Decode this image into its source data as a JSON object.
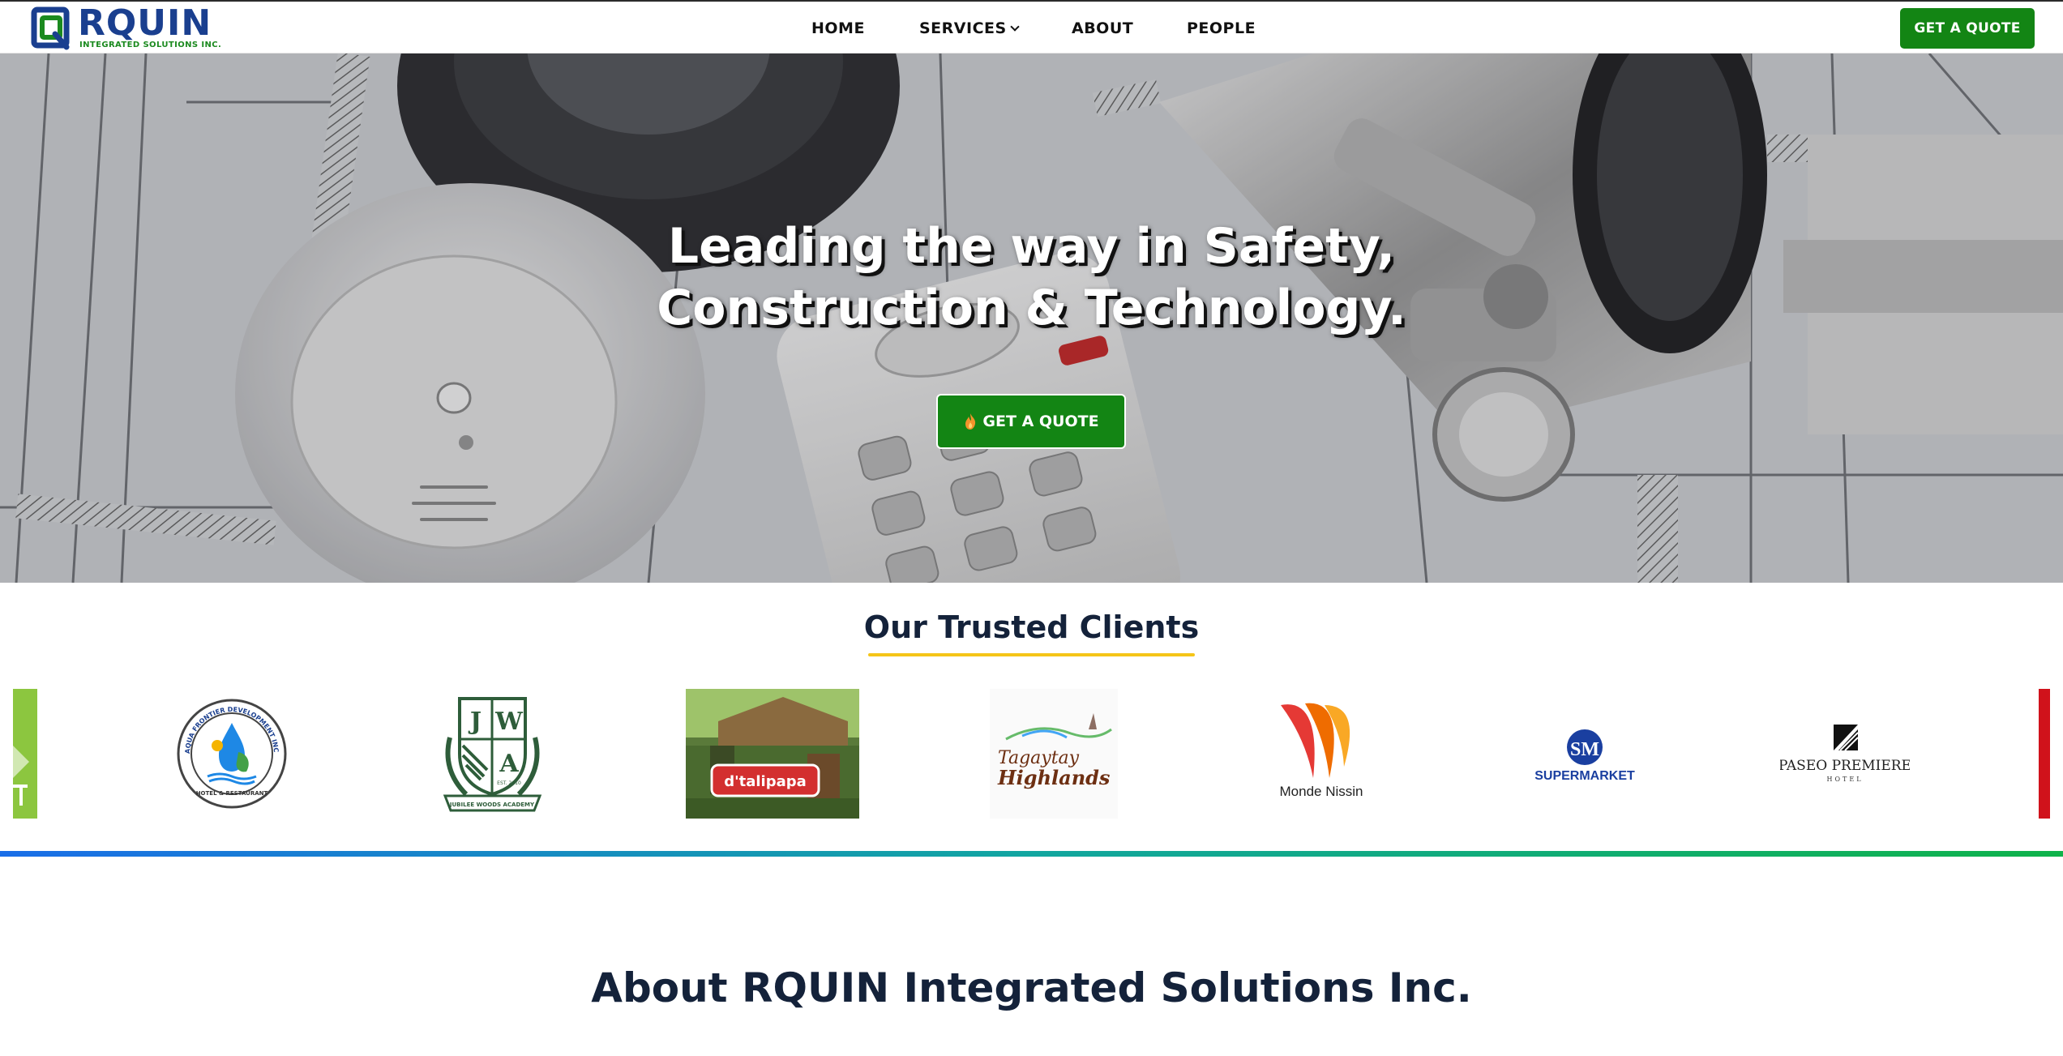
{
  "brand": {
    "name": "RQUIN",
    "tagline": "INTEGRATED SOLUTIONS INC.",
    "primary_color": "#1a3f8f",
    "accent_color": "#138514"
  },
  "nav": {
    "home": "HOME",
    "services": "SERVICES",
    "about": "ABOUT",
    "people": "PEOPLE",
    "cta": "GET A QUOTE"
  },
  "hero": {
    "title_line1": "Leading the way in Safety,",
    "title_line2": "Construction & Technology.",
    "cta": "GET A QUOTE",
    "cta_icon": "flame-icon"
  },
  "clients": {
    "title": "Our Trusted Clients",
    "logos": [
      {
        "name": "Aqua Frontier Development Incorporated",
        "ring_text": "AQUA FRONTIER DEVELOPMENT INCORPORATED",
        "sub": "HOTEL & RESTAURANT"
      },
      {
        "name": "Jubilee Woods Academy",
        "letters": [
          "J",
          "W",
          "A"
        ],
        "est": "EST. 2010",
        "banner": "JUBILEE WOODS ACADEMY"
      },
      {
        "name": "d'talipapa",
        "text": "d'talipapa"
      },
      {
        "name": "Tagaytay Highlands",
        "line1": "Tagaytay",
        "line2": "Highlands"
      },
      {
        "name": "Monde Nissin",
        "text": "Monde Nissin"
      },
      {
        "name": "SM Supermarket",
        "mark": "SM",
        "text": "SUPERMARKET"
      },
      {
        "name": "Paseo Premiere Hotel",
        "line1": "PASEO PREMIERE",
        "line2": "HOTEL"
      }
    ]
  },
  "about": {
    "title": "About RQUIN Integrated Solutions Inc."
  }
}
